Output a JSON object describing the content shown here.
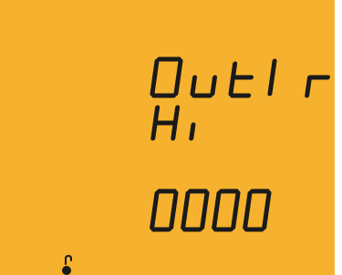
{
  "display": {
    "line1": "Out1r",
    "line2": "Hi",
    "line3": "0000",
    "segment_color": "#1a1a1a",
    "background_color": "#f6b22e",
    "lock_icon": "unlocked-padlock-icon"
  }
}
